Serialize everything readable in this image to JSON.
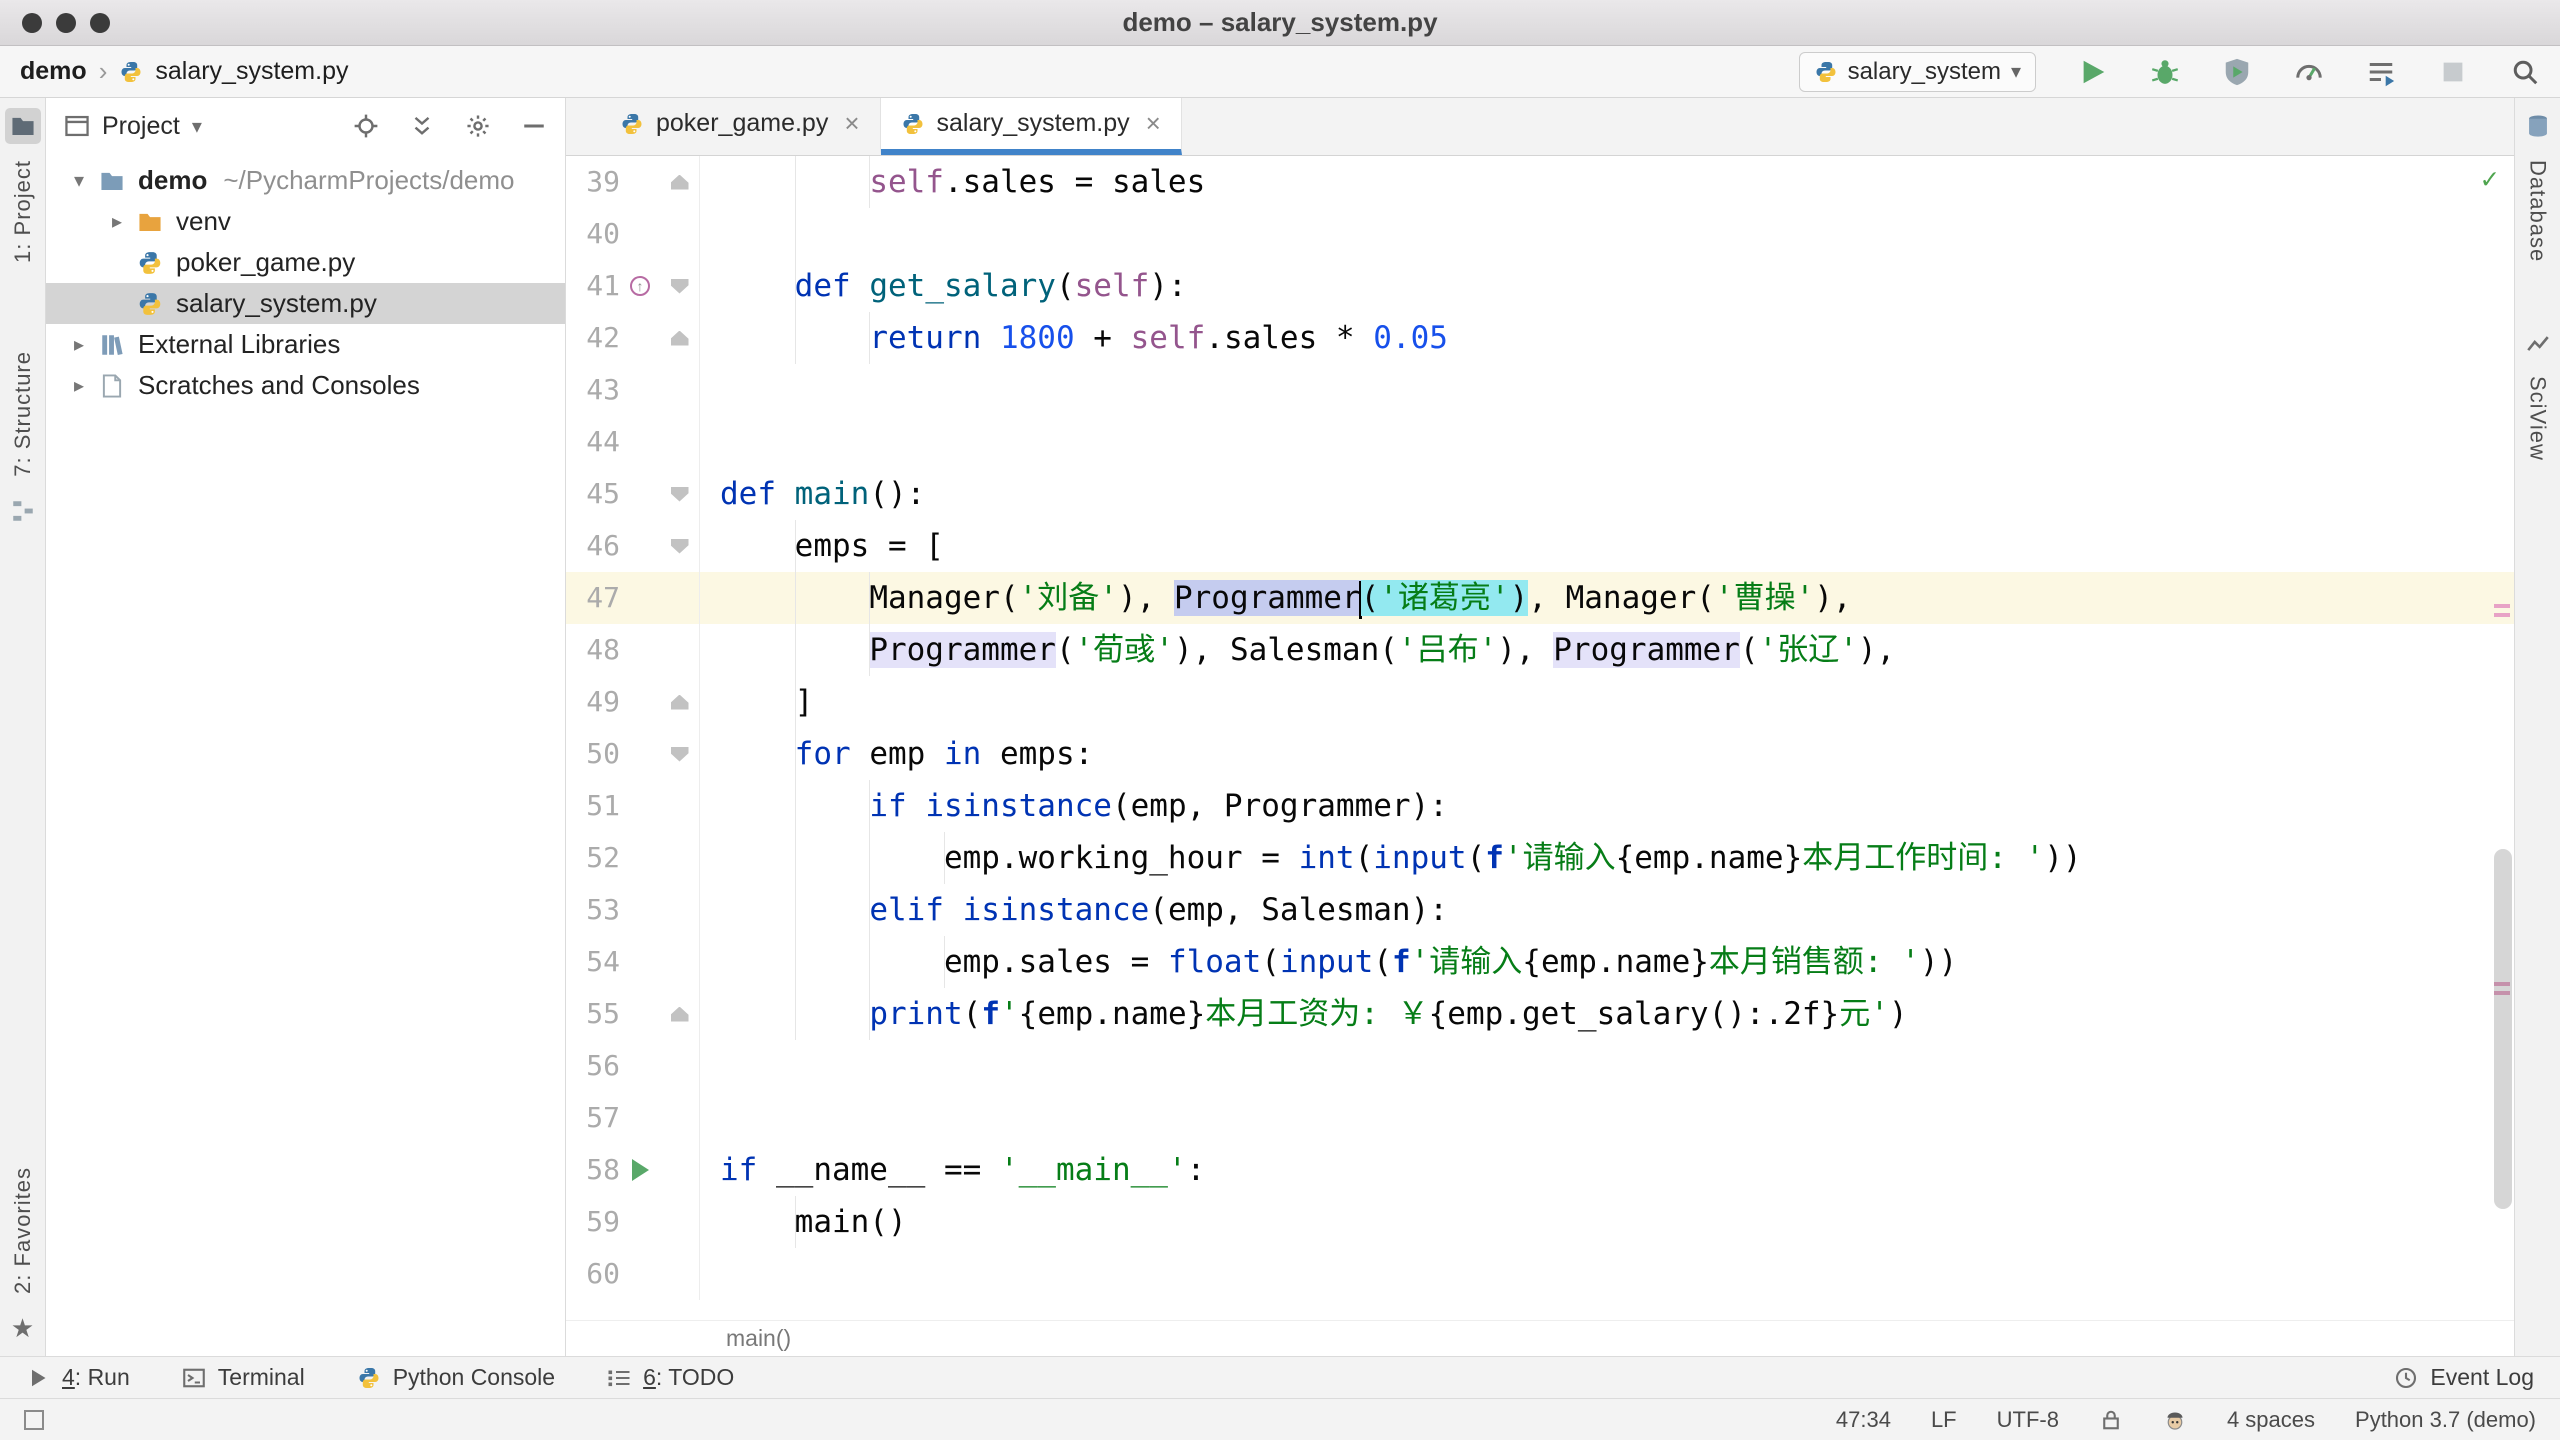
{
  "window": {
    "title": "demo – salary_system.py"
  },
  "toolbar": {
    "project_crumb": "demo",
    "file_crumb": "salary_system.py",
    "run_config": "salary_system"
  },
  "left_stripe": {
    "project": "1: Project",
    "structure": "7: Structure",
    "favorites": "2: Favorites"
  },
  "right_stripe": {
    "database": "Database",
    "sciview": "SciView"
  },
  "project_panel": {
    "title": "Project",
    "tree": [
      {
        "depth": 0,
        "arrow": "down",
        "icon": "folder-project",
        "label": "demo",
        "bold": true,
        "path": "~/PycharmProjects/demo"
      },
      {
        "depth": 1,
        "arrow": "right",
        "icon": "folder-excluded",
        "label": "venv"
      },
      {
        "depth": 1,
        "icon": "python-file",
        "label": "poker_game.py"
      },
      {
        "depth": 1,
        "icon": "python-file",
        "label": "salary_system.py",
        "selected": true
      },
      {
        "depth": 0,
        "arrow": "right",
        "icon": "libraries",
        "label": "External Libraries"
      },
      {
        "depth": 0,
        "arrow": "right",
        "icon": "scratches",
        "label": "Scratches and Consoles"
      }
    ]
  },
  "tabs": [
    {
      "label": "poker_game.py",
      "active": false
    },
    {
      "label": "salary_system.py",
      "active": true
    }
  ],
  "editor": {
    "breadcrumb": "main()",
    "lines": [
      {
        "n": 39,
        "fold": "up",
        "guides": [
          4,
          8
        ],
        "tokens": [
          {
            "t": "        "
          },
          {
            "t": "self",
            "c": "self"
          },
          {
            "t": ".sales = sales"
          }
        ]
      },
      {
        "n": 40,
        "guides": [
          4
        ],
        "tokens": []
      },
      {
        "n": 41,
        "gutter": "override",
        "fold": "down",
        "guides": [
          4
        ],
        "tokens": [
          {
            "t": "    "
          },
          {
            "t": "def",
            "c": "kw"
          },
          {
            "t": " "
          },
          {
            "t": "get_salary",
            "c": "fn"
          },
          {
            "t": "("
          },
          {
            "t": "self",
            "c": "self"
          },
          {
            "t": "):"
          }
        ]
      },
      {
        "n": 42,
        "fold": "up",
        "guides": [
          4,
          8
        ],
        "tokens": [
          {
            "t": "        "
          },
          {
            "t": "return",
            "c": "kw"
          },
          {
            "t": " "
          },
          {
            "t": "1800",
            "c": "num"
          },
          {
            "t": " + "
          },
          {
            "t": "self",
            "c": "self"
          },
          {
            "t": ".sales * "
          },
          {
            "t": "0.05",
            "c": "num"
          }
        ]
      },
      {
        "n": 43,
        "tokens": []
      },
      {
        "n": 44,
        "tokens": []
      },
      {
        "n": 45,
        "fold": "down",
        "tokens": [
          {
            "t": "def",
            "c": "kw"
          },
          {
            "t": " "
          },
          {
            "t": "main",
            "c": "fn"
          },
          {
            "t": "():"
          }
        ]
      },
      {
        "n": 46,
        "fold": "down",
        "guides": [
          4
        ],
        "tokens": [
          {
            "t": "    emps = ["
          }
        ]
      },
      {
        "n": 47,
        "current": true,
        "guides": [
          4,
          8
        ],
        "tokens": [
          {
            "t": "        "
          },
          {
            "t": "Manager("
          },
          {
            "t": "'刘备'",
            "c": "str"
          },
          {
            "t": "), "
          },
          {
            "t": "Programmer",
            "hl": "word"
          },
          {
            "caret": true
          },
          {
            "t": "(",
            "hl": "cyan"
          },
          {
            "t": "'诸葛亮'",
            "c": "str",
            "hl": "cyan"
          },
          {
            "t": ")",
            "hl": "cyan"
          },
          {
            "t": ", Manager("
          },
          {
            "t": "'曹操'",
            "c": "str"
          },
          {
            "t": "),"
          }
        ]
      },
      {
        "n": 48,
        "guides": [
          4,
          8
        ],
        "tokens": [
          {
            "t": "        "
          },
          {
            "t": "Programmer",
            "hl": "usage"
          },
          {
            "t": "("
          },
          {
            "t": "'荀彧'",
            "c": "str"
          },
          {
            "t": "), Salesman("
          },
          {
            "t": "'吕布'",
            "c": "str"
          },
          {
            "t": "), "
          },
          {
            "t": "Programmer",
            "hl": "usage"
          },
          {
            "t": "("
          },
          {
            "t": "'张辽'",
            "c": "str"
          },
          {
            "t": "),"
          }
        ]
      },
      {
        "n": 49,
        "fold": "up",
        "guides": [
          4
        ],
        "tokens": [
          {
            "t": "    ]"
          }
        ]
      },
      {
        "n": 50,
        "fold": "down",
        "guides": [
          4
        ],
        "tokens": [
          {
            "t": "    "
          },
          {
            "t": "for",
            "c": "kw"
          },
          {
            "t": " emp "
          },
          {
            "t": "in",
            "c": "kw"
          },
          {
            "t": " emps:"
          }
        ]
      },
      {
        "n": 51,
        "guides": [
          4,
          8
        ],
        "tokens": [
          {
            "t": "        "
          },
          {
            "t": "if",
            "c": "kw"
          },
          {
            "t": " "
          },
          {
            "t": "isinstance",
            "c": "bi"
          },
          {
            "t": "(emp, Programmer):"
          }
        ]
      },
      {
        "n": 52,
        "guides": [
          4,
          8,
          12
        ],
        "tokens": [
          {
            "t": "            emp.working_hour = "
          },
          {
            "t": "int",
            "c": "bi"
          },
          {
            "t": "("
          },
          {
            "t": "input",
            "c": "bi"
          },
          {
            "t": "("
          },
          {
            "t": "f",
            "c": "fmod"
          },
          {
            "t": "'请输入",
            "c": "str"
          },
          {
            "t": "{emp.name}"
          },
          {
            "t": "本月工作时间: '",
            "c": "str"
          },
          {
            "t": "))"
          }
        ]
      },
      {
        "n": 53,
        "guides": [
          4,
          8
        ],
        "tokens": [
          {
            "t": "        "
          },
          {
            "t": "elif",
            "c": "kw"
          },
          {
            "t": " "
          },
          {
            "t": "isinstance",
            "c": "bi"
          },
          {
            "t": "(emp, Salesman):"
          }
        ]
      },
      {
        "n": 54,
        "guides": [
          4,
          8,
          12
        ],
        "tokens": [
          {
            "t": "            emp.sales = "
          },
          {
            "t": "float",
            "c": "bi"
          },
          {
            "t": "("
          },
          {
            "t": "input",
            "c": "bi"
          },
          {
            "t": "("
          },
          {
            "t": "f",
            "c": "fmod"
          },
          {
            "t": "'请输入",
            "c": "str"
          },
          {
            "t": "{emp.name}"
          },
          {
            "t": "本月销售额: '",
            "c": "str"
          },
          {
            "t": "))"
          }
        ]
      },
      {
        "n": 55,
        "fold": "up",
        "guides": [
          4,
          8
        ],
        "tokens": [
          {
            "t": "        "
          },
          {
            "t": "print",
            "c": "bi"
          },
          {
            "t": "("
          },
          {
            "t": "f",
            "c": "fmod"
          },
          {
            "t": "'",
            "c": "str"
          },
          {
            "t": "{emp.name}"
          },
          {
            "t": "本月工资为: ￥",
            "c": "str"
          },
          {
            "t": "{emp.get_salary():.2f}"
          },
          {
            "t": "元'",
            "c": "str"
          },
          {
            "t": ")"
          }
        ]
      },
      {
        "n": 56,
        "tokens": []
      },
      {
        "n": 57,
        "tokens": []
      },
      {
        "n": 58,
        "gutter": "run",
        "tokens": [
          {
            "t": "if",
            "c": "kw"
          },
          {
            "t": " __name__ == "
          },
          {
            "t": "'__main__'",
            "c": "str"
          },
          {
            "t": ":"
          }
        ]
      },
      {
        "n": 59,
        "guides": [
          4
        ],
        "tokens": [
          {
            "t": "    main()"
          }
        ]
      },
      {
        "n": 60,
        "tokens": []
      }
    ]
  },
  "bottom_bar": {
    "items": [
      {
        "icon": "run",
        "shortcut": "4",
        "label": ": Run"
      },
      {
        "icon": "terminal",
        "label": "Terminal"
      },
      {
        "icon": "python",
        "label": "Python Console"
      },
      {
        "icon": "todo",
        "shortcut": "6",
        "label": ": TODO"
      }
    ],
    "event_log": "Event Log"
  },
  "status_bar": {
    "position": "47:34",
    "line_ending": "LF",
    "encoding": "UTF-8",
    "indent": "4 spaces",
    "interpreter": "Python 3.7 (demo)"
  },
  "colors": {
    "tab_accent": "#4083C9",
    "run_green": "#59A869",
    "keyword": "#0033B3",
    "string": "#067D17",
    "number": "#1750EB",
    "self": "#94558D",
    "current_line": "#FCF8E3",
    "tree_selection": "#D4D4D4",
    "word_highlight": "#C5CCEF",
    "cyan_highlight": "#93E9F0",
    "usage_highlight": "#E4E2F9"
  }
}
